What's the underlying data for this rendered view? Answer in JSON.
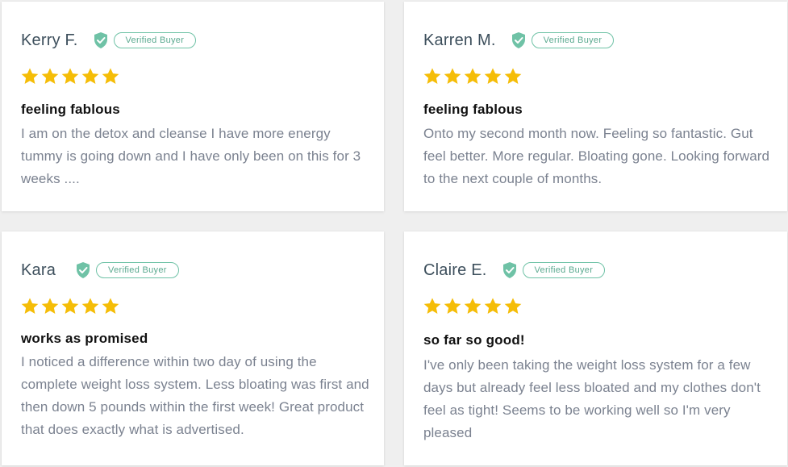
{
  "reviews": [
    {
      "name": "Kerry F.",
      "badge": "Verified Buyer",
      "rating": 5,
      "title": "feeling fablous",
      "text": "I am on the detox and cleanse I have  more energy tummy is going down and I have only been on this for 3 weeks ...."
    },
    {
      "name": "Karren M.",
      "badge": "Verified Buyer",
      "rating": 5,
      "title": "feeling fablous",
      "text": "Onto my second month now. Feeling so fantastic. Gut feel better. More regular. Bloating gone. Looking forward to the next couple of months."
    },
    {
      "name": "Kara",
      "badge": "Verified Buyer",
      "rating": 5,
      "title": "works as promised",
      "text": "I noticed a difference within two day of using the complete weight loss system. Less bloating was first and then down 5 pounds within the first week! Great product that does exactly what is advertised."
    },
    {
      "name": "Claire E.",
      "badge": "Verified Buyer",
      "rating": 5,
      "title": "so far so good!",
      "text": "I've only been taking the weight loss system for a few days but already feel less bloated and my clothes don't feel as tight! Seems to be working well so I'm very pleased"
    }
  ],
  "colors": {
    "star": "#f5bd07",
    "shield": "#6fc2a6",
    "badge_border": "#6fc2a6",
    "name": "#3d4f5c",
    "body_text": "#7b8290"
  },
  "icons": {
    "verified": "shield-check-icon",
    "rating": "star-icon"
  }
}
